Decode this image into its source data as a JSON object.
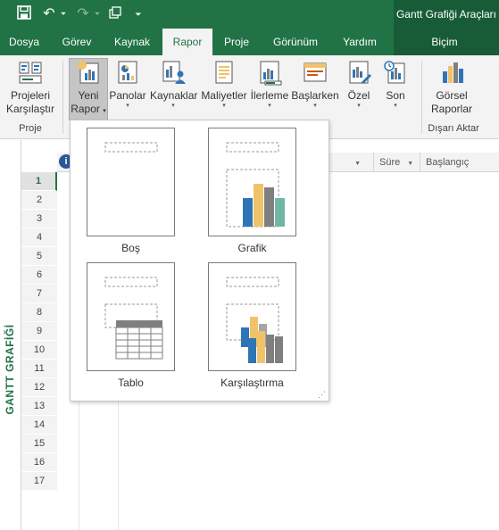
{
  "titlebar": {
    "qat_undo": "↶",
    "qat_redo": "↷",
    "qat_more": "⏷",
    "tools_title": "Gantt Grafiği Araçları"
  },
  "tabs": [
    {
      "label": "Dosya"
    },
    {
      "label": "Görev"
    },
    {
      "label": "Kaynak"
    },
    {
      "label": "Rapor"
    },
    {
      "label": "Proje"
    },
    {
      "label": "Görünüm"
    },
    {
      "label": "Yardım"
    },
    {
      "label": "Biçim"
    }
  ],
  "active_tab": "Rapor",
  "ribbon": {
    "buttons": [
      {
        "line1": "Projeleri",
        "line2": "Karşılaştır",
        "icon": "compare-projects-icon"
      },
      {
        "line1": "Yeni",
        "line2": "Rapor",
        "icon": "new-report-icon",
        "caret": "▾"
      },
      {
        "line1": "Panolar",
        "icon": "dashboards-icon",
        "caret": "▾"
      },
      {
        "line1": "Kaynaklar",
        "icon": "resources-icon",
        "caret": "▾"
      },
      {
        "line1": "Maliyetler",
        "icon": "costs-icon",
        "caret": "▾"
      },
      {
        "line1": "İlerleme",
        "icon": "progress-icon",
        "caret": "▾"
      },
      {
        "line1": "Başlarken",
        "icon": "getting-started-icon",
        "caret": "▾"
      },
      {
        "line1": "Özel",
        "icon": "custom-icon",
        "caret": "▾"
      },
      {
        "line1": "Son",
        "icon": "recent-icon",
        "caret": "▾"
      },
      {
        "line1": "Görsel",
        "line2": "Raporlar",
        "icon": "visual-reports-icon"
      }
    ],
    "groups": {
      "project": "Proje",
      "export": "Dışarı Aktar"
    }
  },
  "new_report_menu": {
    "options": [
      {
        "label": "Boş"
      },
      {
        "label": "Grafik"
      },
      {
        "label": "Tablo"
      },
      {
        "label": "Karşılaştırma"
      }
    ],
    "resize_grip": "⋰"
  },
  "gantt": {
    "view_label": "GANTT GRAFİĞİ",
    "info_glyph": "i",
    "columns": [
      {
        "label": "Süre",
        "dropdown": "▼"
      },
      {
        "label": "Başlangıç",
        "dropdown": "▼"
      }
    ],
    "name_column_dropdown": "▼",
    "rows": [
      "1",
      "2",
      "3",
      "4",
      "5",
      "6",
      "7",
      "8",
      "9",
      "10",
      "11",
      "12",
      "13",
      "14",
      "15",
      "16",
      "17"
    ],
    "selected_row": "1"
  },
  "colors": {
    "brand_green": "#217346",
    "tools_green": "#185c37",
    "chart_blue": "#2e75b6",
    "chart_gold": "#f0c36a",
    "chart_gray": "#7f7f7f",
    "chart_teal": "#6fb7a3",
    "chart_gray_light": "#a5a5a5"
  }
}
